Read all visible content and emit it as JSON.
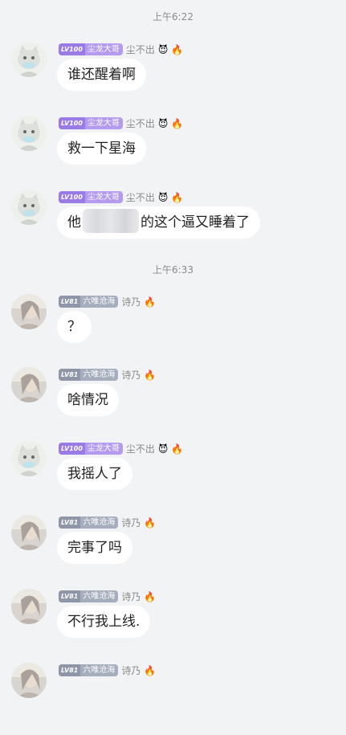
{
  "times": [
    "上午6:22",
    "上午6:33"
  ],
  "users": {
    "chenlong": {
      "level": "LV100",
      "name": "尘龙大哥",
      "title": "尘不出"
    },
    "shinai": {
      "level": "LV81",
      "name": "六唯沧海",
      "title": "诗乃"
    }
  },
  "messages": [
    {
      "text": "谁还醒着啊"
    },
    {
      "text": "救一下星海"
    },
    {
      "text_before": "他",
      "text_after": "的这个逼又睡着了"
    },
    {
      "text": "？"
    },
    {
      "text": "啥情况"
    },
    {
      "text": "我摇人了"
    },
    {
      "text": "完事了吗"
    },
    {
      "text": "不行我上线."
    },
    {
      "text": ""
    }
  ]
}
